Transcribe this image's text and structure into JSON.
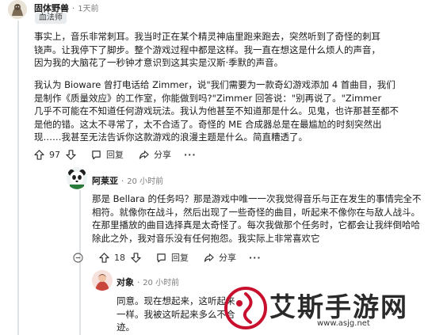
{
  "comments": [
    {
      "username": "固体野兽",
      "time": "1天前",
      "flair": "血法师",
      "paragraphs": [
        [
          "事实上，音乐非常刺耳。我当时正在某个精灵神庙里跑来跑去，突然听到了奇怪的刺耳",
          "铙声。让我停下了脚步。整个游戏过程中都是这样。我一直在想这是什么烦人的声音，",
          "因为我的大脑花了一秒钟才意识到这其实是汉斯·季默的声音。"
        ],
        [
          "我认为 Bioware 曾打电话给 Zimmer，说\"我们需要为一款奇幻游戏添加 4 首曲目，我们",
          "是制作《质量效应》的工作室，你能做到吗?\"Zimmer 回答说：\"别再说了。\"Zimmer",
          "几乎不可能在不知道任何游戏玩法。我认为他甚至不知道那是什么。见鬼，也许那甚至都不",
          "是他的错。这太不寻常了，太不合适了。奇怪的 ME 合成器总是在最尴尬的时刻突然出",
          "现……我甚至无法告诉你这款游戏的浪漫主题是什么。简直糟透了。"
        ]
      ],
      "votes": "97",
      "reply_label": "回复",
      "share_label": "分享",
      "more_label": "···"
    },
    {
      "username": "阿莱亚",
      "time": "20 小时前",
      "paragraphs": [
        [
          "那是 Bellara 的任务吗？那是游戏中唯一一次我觉得音乐与正在发生的事情完全不",
          "相符。就像你在战斗，然后出现了一些奇怪的曲目，听起来不像你在与敌人战斗。",
          "在那里播放的曲目选择真是太奇怪了。每次我做那个任务时，它都会让我绊倒哈哈",
          "除此之外，我对音乐没有任何抱怨。我实际上非常喜欢它"
        ]
      ],
      "votes": "18",
      "reply_label": "回复",
      "share_label": "分享",
      "more_label": "···"
    },
    {
      "username": "对象",
      "time": "20 小时前",
      "paragraphs": [
        [
          "同意。现在想起来，这听起来",
          "一样。我被这听起来多么不合",
          "迹。"
        ]
      ]
    }
  ],
  "watermark": {
    "title": "艾斯手游网",
    "url": "www.asjg.net"
  },
  "colors": {
    "thread_line": "#dfe3e6",
    "meta_gray": "#7c7c7c",
    "flair_bg": "#e9ecef",
    "watermark_red": "#c8102e"
  }
}
